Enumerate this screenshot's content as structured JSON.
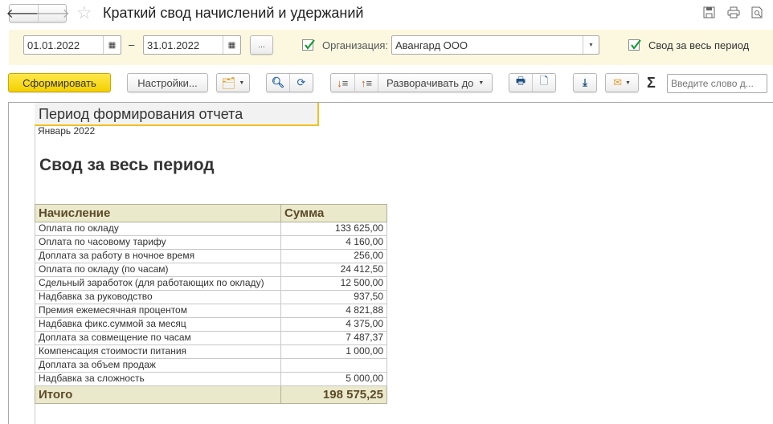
{
  "window": {
    "title": "Краткий свод начислений и удержаний",
    "icons": [
      "back-arrow",
      "forward-arrow",
      "star",
      "save",
      "print",
      "preview"
    ]
  },
  "filters": {
    "date_from": "01.01.2022",
    "date_sep": "–",
    "date_to": "31.01.2022",
    "period_button": "...",
    "org_checked": true,
    "org_label": "Организация:",
    "org_value": "Авангард ООО",
    "summary_checked": true,
    "summary_label": "Свод за весь период"
  },
  "toolbar": {
    "generate": "Сформировать",
    "settings": "Настройки...",
    "expand": "Разворачивать до",
    "search_placeholder": "Введите слово д..."
  },
  "report": {
    "period_header": "Период формирования отчета",
    "period_value": "Январь 2022",
    "title": "Свод за весь период",
    "columns": [
      "Начисление",
      "Сумма"
    ],
    "rows": [
      [
        "Оплата по окладу",
        "133 625,00"
      ],
      [
        "Оплата по часовому тарифу",
        "4 160,00"
      ],
      [
        "Доплата за работу в ночное время",
        "256,00"
      ],
      [
        "Оплата по окладу (по часам)",
        "24 412,50"
      ],
      [
        "Сдельный заработок (для работающих по окладу)",
        "12 500,00"
      ],
      [
        "Надбавка за руководство",
        "937,50"
      ],
      [
        "Премия ежемесячная процентом",
        "4 821,88"
      ],
      [
        "Надбавка фикс.суммой за месяц",
        "4 375,00"
      ],
      [
        "Доплата за совмещение по часам",
        "7 487,37"
      ],
      [
        "Компенсация стоимости питания",
        "1 000,00"
      ],
      [
        "Доплата за объем продаж",
        ""
      ],
      [
        "Надбавка за сложность",
        "5 000,00"
      ]
    ],
    "total": [
      "Итого",
      "198 575,25"
    ]
  },
  "colors": {
    "accent": "#f5d800",
    "filter_bg": "#fcf8e0",
    "header_bg": "#ebe9cb"
  }
}
